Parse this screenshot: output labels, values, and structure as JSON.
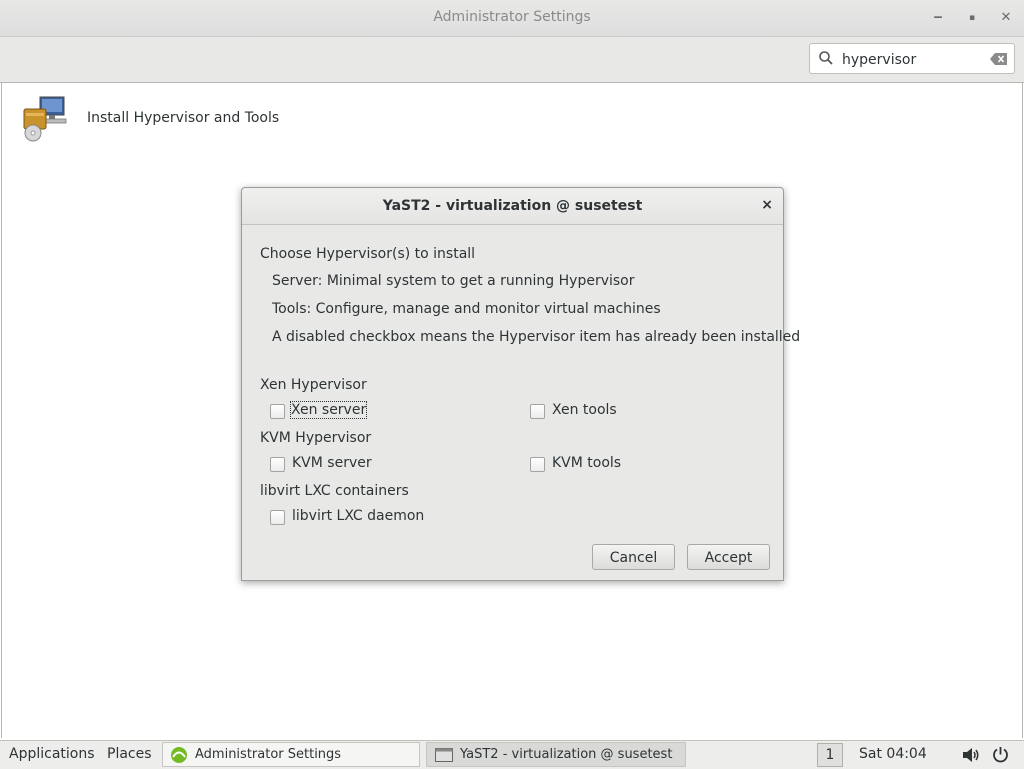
{
  "window": {
    "title": "Administrator Settings",
    "controls": {
      "minimize": "‒",
      "maximize": "▪",
      "close": "✕"
    }
  },
  "search": {
    "value": "hypervisor",
    "placeholder": ""
  },
  "modules": [
    {
      "label": "Install Hypervisor and Tools",
      "icon": "hypervisor-install-icon"
    }
  ],
  "dialog": {
    "title": "YaST2 - virtualization @ susetest",
    "close": "×",
    "heading": "Choose Hypervisor(s) to install",
    "lines": [
      "Server: Minimal system to get a running Hypervisor",
      "Tools: Configure, manage and monitor virtual machines",
      "A disabled checkbox means the Hypervisor item has already been installed"
    ],
    "groups": [
      {
        "label": "Xen Hypervisor",
        "server": {
          "label": "Xen server",
          "checked": false
        },
        "tools": {
          "label": "Xen tools",
          "checked": false
        }
      },
      {
        "label": "KVM Hypervisor",
        "server": {
          "label": "KVM server",
          "checked": false
        },
        "tools": {
          "label": "KVM tools",
          "checked": false
        }
      },
      {
        "label": "libvirt LXC containers",
        "server": {
          "label": "libvirt LXC daemon",
          "checked": false
        }
      }
    ],
    "buttons": {
      "cancel": "Cancel",
      "accept": "Accept"
    }
  },
  "taskbar": {
    "applications": "Applications",
    "places": "Places",
    "tasks": [
      {
        "label": "Administrator Settings",
        "icon": "yast-icon"
      },
      {
        "label": "YaST2 - virtualization @ susetest",
        "icon": "window-icon"
      }
    ],
    "workspace": "1",
    "clock": "Sat 04:04",
    "icons": [
      "volume-icon",
      "power-icon"
    ]
  }
}
